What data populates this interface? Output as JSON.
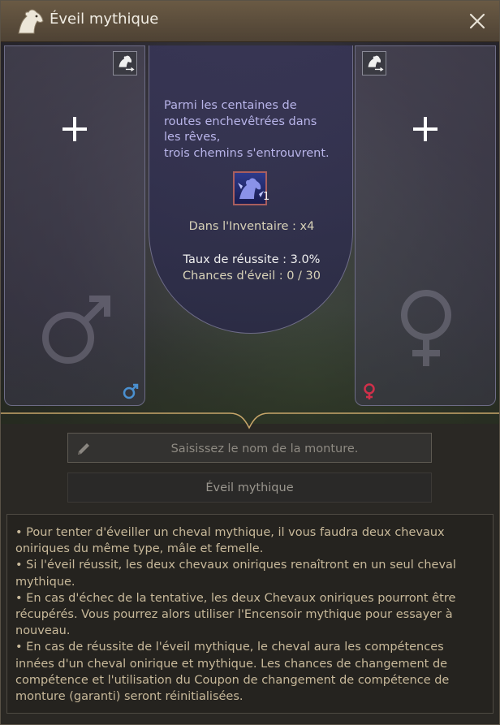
{
  "window": {
    "title": "Éveil mythique",
    "icons": {
      "title": "horse-head-icon",
      "close": "close-icon"
    }
  },
  "slots": {
    "left": {
      "gender": "male",
      "gender_icon": "male-icon",
      "add_icon": "plus-icon",
      "swap_icon": "horse-swap-icon",
      "accent": "#4a90d0"
    },
    "right": {
      "gender": "female",
      "gender_icon": "female-icon",
      "add_icon": "plus-icon",
      "swap_icon": "horse-swap-icon",
      "accent": "#d0304a"
    }
  },
  "center": {
    "flavor_lines": [
      "Parmi les centaines de",
      "routes enchevêtrées dans",
      "les rêves,",
      "trois chemins s'entrouvrent."
    ],
    "item": {
      "icon": "mythic-horse-item-icon",
      "count": "1"
    },
    "inventory_text": "Dans l'Inventaire : x4",
    "success_rate_text": "Taux de réussite : 3.0%",
    "awakening_chances_text": "Chances d'éveil : 0 / 30"
  },
  "name_input": {
    "placeholder": "Saisissez le nom de la monture.",
    "value": "",
    "icon": "pencil-icon"
  },
  "action_button": {
    "label": "Éveil mythique"
  },
  "description": {
    "lines": [
      "• Pour tenter d'éveiller un cheval mythique, il vous faudra deux chevaux",
      "oniriques du même type, mâle et femelle.",
      "• Si l'éveil réussit, les deux chevaux oniriques renaîtront en un seul cheval",
      "mythique.",
      "• En cas d'échec de la tentative, les deux Chevaux oniriques pourront être",
      "récupérés. Vous pourrez alors utiliser l'Encensoir mythique pour essayer à",
      "nouveau.",
      "• En cas de réussite de l'éveil mythique, le cheval aura les compétences",
      "innées d'un cheval onirique et mythique. Les chances de changement de",
      "compétence et l'utilisation du Coupon de changement de compétence de",
      "monture (garanti) seront réinitialisées."
    ]
  },
  "colors": {
    "title_bar": "#5c4e3c",
    "flavor_text": "#b9b5ea",
    "description_text": "#c8b99a",
    "male_accent": "#4a90d0",
    "female_accent": "#d0304a"
  }
}
